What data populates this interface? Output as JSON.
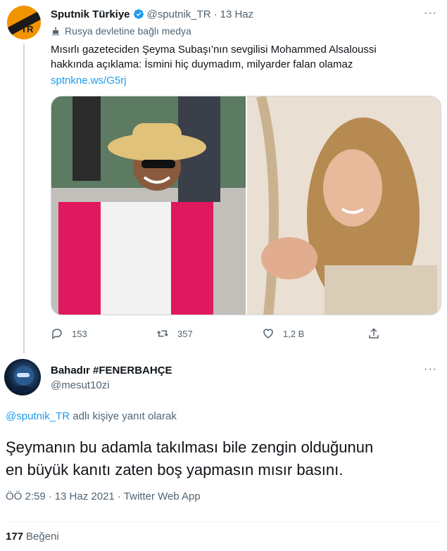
{
  "tweet1": {
    "author_name": "Sputnik Türkiye",
    "handle": "@sputnik_TR",
    "date": "13 Haz",
    "avatar_text": "TR",
    "state_media_label": "Rusya devletine bağlı medya",
    "text_line1": "Mısırlı gazeteciden Şeyma Subaşı’nın sevgilisi Mohammed Alsaloussi",
    "text_line2": "hakkında açıklama: İsmini hiç duymadım, milyarder falan olamaz",
    "link": "sptnkne.ws/G5rj",
    "replies": "153",
    "retweets": "357",
    "likes": "1,2 B"
  },
  "tweet2": {
    "author_name": "Bahadır #FENERBAHÇE",
    "handle": "@mesut10zi",
    "reply_mention": "@sputnik_TR",
    "reply_suffix": " adlı kişiye yanıt olarak",
    "text_line1": "Şeymanın bu adamla takılması bile zengin olduğunun",
    "text_line2": "en büyük kanıtı zaten boş yapmasın mısır basını.",
    "time": "ÖÖ 2:59",
    "date": "13 Haz 2021",
    "source": "Twitter Web App",
    "like_count": "177",
    "like_label": "Beğeni"
  },
  "colors": {
    "accent": "#1d9bf0",
    "muted": "#536471",
    "text": "#0f1419",
    "verified": "#1d9bf0",
    "sputnik_orange": "#f29400"
  },
  "icons": {
    "verified": "verified-badge-icon",
    "state_media": "state-media-flag-icon",
    "reply": "reply-icon",
    "retweet": "retweet-icon",
    "like": "heart-icon",
    "share": "share-icon",
    "more": "more-icon"
  }
}
